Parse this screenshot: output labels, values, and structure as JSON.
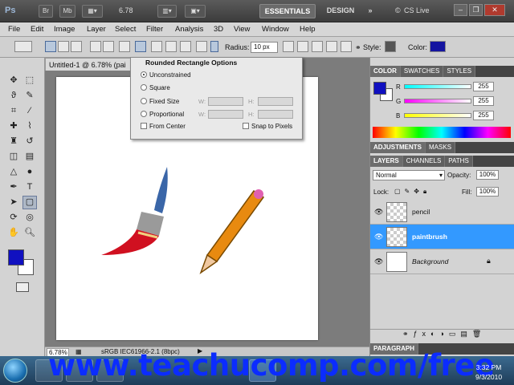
{
  "app": {
    "logo": "Ps",
    "zoom": "6.78",
    "workspaces": {
      "essentials": "ESSENTIALS",
      "design": "DESIGN",
      "more": "»"
    },
    "cs_live": "CS Live"
  },
  "menu": [
    "File",
    "Edit",
    "Image",
    "Layer",
    "Select",
    "Filter",
    "Analysis",
    "3D",
    "View",
    "Window",
    "Help"
  ],
  "options_bar": {
    "radius_label": "Radius:",
    "radius_value": "10 px",
    "style_label": "Style:",
    "color_label": "Color:",
    "color": "#1414a0"
  },
  "popup": {
    "title": "Rounded Rectangle Options",
    "unconstrained": "Unconstrained",
    "square": "Square",
    "fixed_size": "Fixed Size",
    "proportional": "Proportional",
    "w": "W:",
    "h": "H:",
    "from_center": "From Center",
    "snap": "Snap to Pixels"
  },
  "document": {
    "tab": "Untitled-1 @ 6.78% (pai",
    "zoom": "6.78%",
    "profile": "sRGB IEC61966-2.1 (8bpc)"
  },
  "toolbox": {
    "fg": "#1010c0",
    "bg": "#ffffff"
  },
  "color_panel": {
    "tabs": [
      "COLOR",
      "SWATCHES",
      "STYLES"
    ],
    "r": "R",
    "g": "G",
    "b": "B",
    "r_val": "255",
    "g_val": "255",
    "b_val": "255"
  },
  "adjustments_tabs": [
    "ADJUSTMENTS",
    "MASKS"
  ],
  "layers_panel": {
    "tabs": [
      "LAYERS",
      "CHANNELS",
      "PATHS"
    ],
    "blend": "Normal",
    "opacity_label": "Opacity:",
    "opacity": "100%",
    "lock_label": "Lock:",
    "fill_label": "Fill:",
    "fill": "100%",
    "layers": [
      {
        "name": "pencil"
      },
      {
        "name": "paintbrush"
      },
      {
        "name": "Background"
      }
    ]
  },
  "paragraph_tab": "PARAGRAPH",
  "taskbar": {
    "time": "3:32 PM",
    "date": "9/3/2010"
  },
  "watermark": "www.teachucomp.com/free"
}
